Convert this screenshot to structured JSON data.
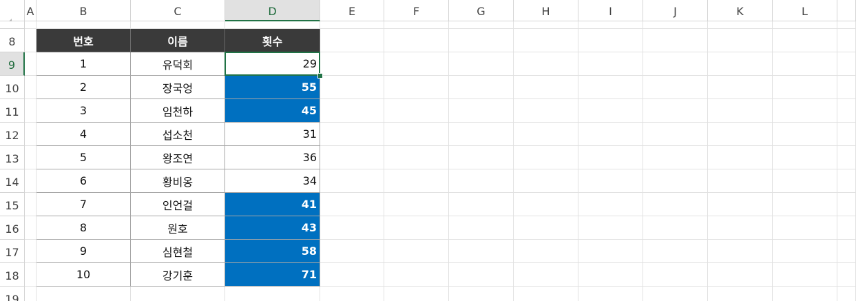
{
  "columns": [
    "A",
    "B",
    "C",
    "D",
    "E",
    "F",
    "G",
    "H",
    "I",
    "J",
    "K",
    "L"
  ],
  "active_column": "D",
  "rows": [
    "8",
    "9",
    "10",
    "11",
    "12",
    "13",
    "14",
    "15",
    "16",
    "17",
    "18",
    "19"
  ],
  "active_row": "9",
  "table": {
    "headers": [
      "번호",
      "이름",
      "횟수"
    ],
    "rows": [
      {
        "no": "1",
        "name": "유덕회",
        "count": "29",
        "highlight": false
      },
      {
        "no": "2",
        "name": "장국엉",
        "count": "55",
        "highlight": true
      },
      {
        "no": "3",
        "name": "임천하",
        "count": "45",
        "highlight": true
      },
      {
        "no": "4",
        "name": "섭소천",
        "count": "31",
        "highlight": false
      },
      {
        "no": "5",
        "name": "왕조연",
        "count": "36",
        "highlight": false
      },
      {
        "no": "6",
        "name": "황비옹",
        "count": "34",
        "highlight": false
      },
      {
        "no": "7",
        "name": "인언걸",
        "count": "41",
        "highlight": true
      },
      {
        "no": "8",
        "name": "원호",
        "count": "43",
        "highlight": true
      },
      {
        "no": "9",
        "name": "심현철",
        "count": "58",
        "highlight": true
      },
      {
        "no": "10",
        "name": "강기훈",
        "count": "71",
        "highlight": true
      }
    ]
  },
  "colors": {
    "highlight_fill": "#0070c0",
    "header_fill": "#3a3a3a",
    "selection": "#217346"
  }
}
